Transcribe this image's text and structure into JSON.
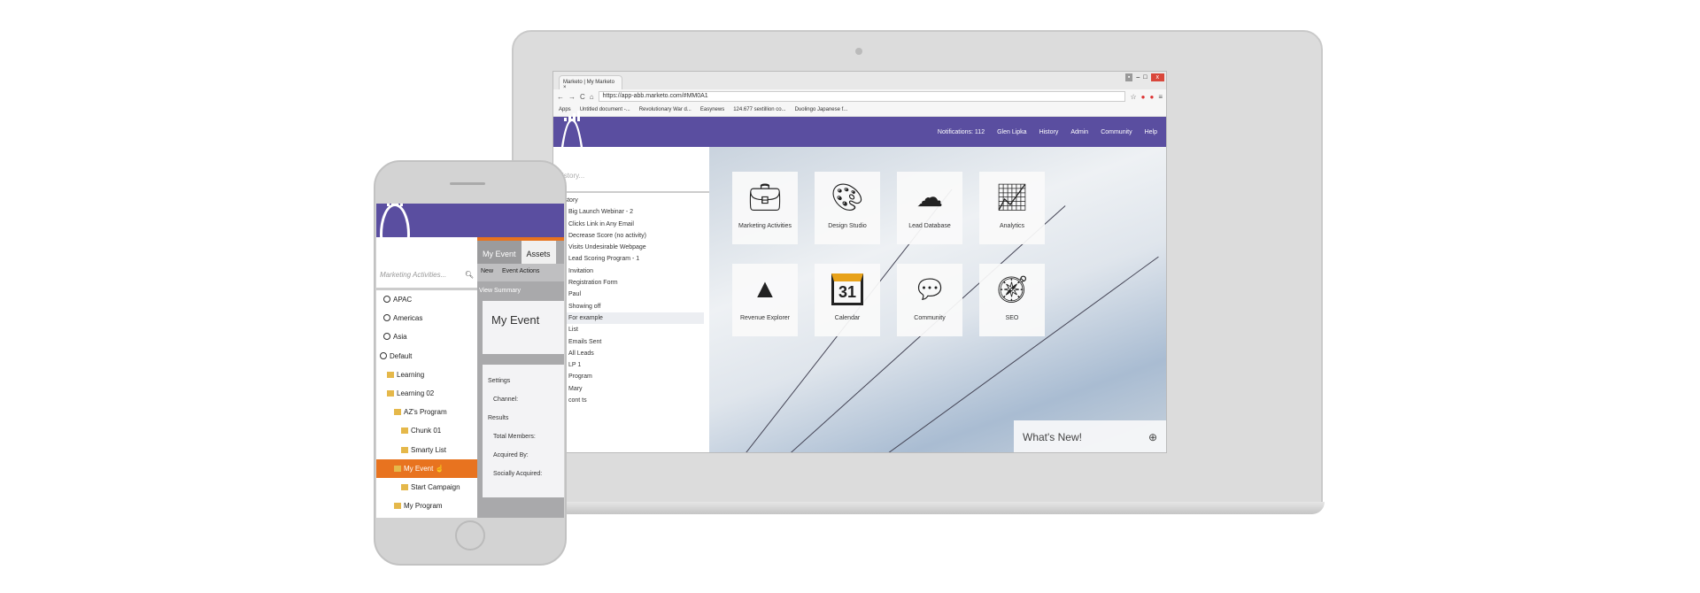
{
  "browser": {
    "tab_title": "Marketo | My Marketo",
    "url": "https://app-abb.marketo.com/#MM0A1",
    "bookmarks": [
      "Apps",
      "Untitled document -...",
      "Revolutionary War d...",
      "Easynews",
      "124.677 sextillion co...",
      "Duolingo Japanese f..."
    ]
  },
  "laptop": {
    "header": {
      "notifications": "Notifications: 112",
      "user": "Glen Lipka",
      "history": "History",
      "admin": "Admin",
      "community": "Community",
      "help": "Help"
    },
    "search_placeholder": "istory...",
    "history_title": "History",
    "history_items": [
      "Big Launch Webinar - 2",
      "Clicks Link in Any Email",
      "Decrease Score (no activity)",
      "Visits Undesirable Webpage",
      "Lead Scoring Program - 1",
      "Invitation",
      "Registration Form",
      "Paul",
      "Showing off",
      "For example",
      "List",
      "Emails Sent",
      "All Leads",
      "LP 1",
      "Program",
      "Mary",
      "cont ts"
    ],
    "selected_history": "For example",
    "tiles": [
      {
        "label": "Marketing Activities",
        "icon": "briefcase-icon"
      },
      {
        "label": "Design Studio",
        "icon": "palette-icon"
      },
      {
        "label": "Lead Database",
        "icon": "database-cloud-icon"
      },
      {
        "label": "Analytics",
        "icon": "presentation-chart-icon"
      },
      {
        "label": "Revenue Explorer",
        "icon": "revenue-explorer-icon"
      },
      {
        "label": "Calendar",
        "icon": "calendar-icon",
        "day": "31"
      },
      {
        "label": "Community",
        "icon": "speech-bubble-icon"
      },
      {
        "label": "SEO",
        "icon": "compass-icon"
      }
    ],
    "whats_new": "What's New!"
  },
  "phone": {
    "search_placeholder": "Marketing Activities...",
    "tree": [
      "APAC",
      "Americas",
      "Asia",
      "Default",
      "Learning",
      "Learning 02",
      "AZ's Program",
      "Chunk 01",
      "Smarty List",
      "My Event",
      "Start Campaign",
      "My Program"
    ],
    "selected_tree": "My Event",
    "tabs": [
      "My Event",
      "Assets"
    ],
    "toolbar": {
      "new": "New",
      "event_actions": "Event Actions"
    },
    "view_summary": "View Summary",
    "card_title": "My Event",
    "settings": "Settings",
    "channel": "Channel:",
    "results": "Results",
    "total_members": "Total Members:",
    "acquired_by": "Acquired By:",
    "socially_acquired": "Socially Acquired:"
  },
  "colors": {
    "brand_purple": "#5a4ea0",
    "selection_orange": "#e8731f"
  }
}
